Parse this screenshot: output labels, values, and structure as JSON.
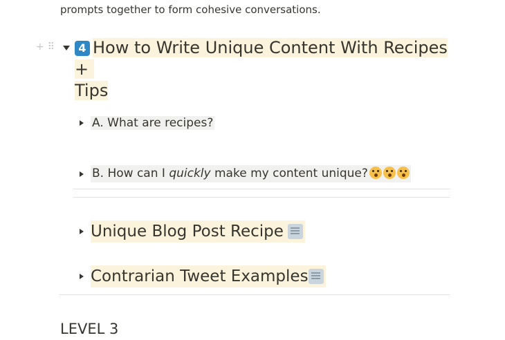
{
  "intro": {
    "line_partial": "prompts together to form cohesive conversations."
  },
  "section": {
    "number_badge": "4",
    "title_line1": "How to Write Unique Content With Recipes +",
    "title_line2": "Tips",
    "toggles": [
      {
        "label": "A. What are recipes?"
      },
      {
        "label_pre": "B. How can I ",
        "label_em": "quickly",
        "label_post": " make my content unique?"
      }
    ],
    "recipes": [
      {
        "label": "Unique Blog Post Recipe"
      },
      {
        "label": "Contrarian Tweet Examples"
      }
    ]
  },
  "next_heading": "LEVEL 3",
  "colors": {
    "highlight_yellow": "#fbf3db",
    "highlight_gray": "#f1f1ef",
    "badge_blue": "#2f88c4"
  }
}
